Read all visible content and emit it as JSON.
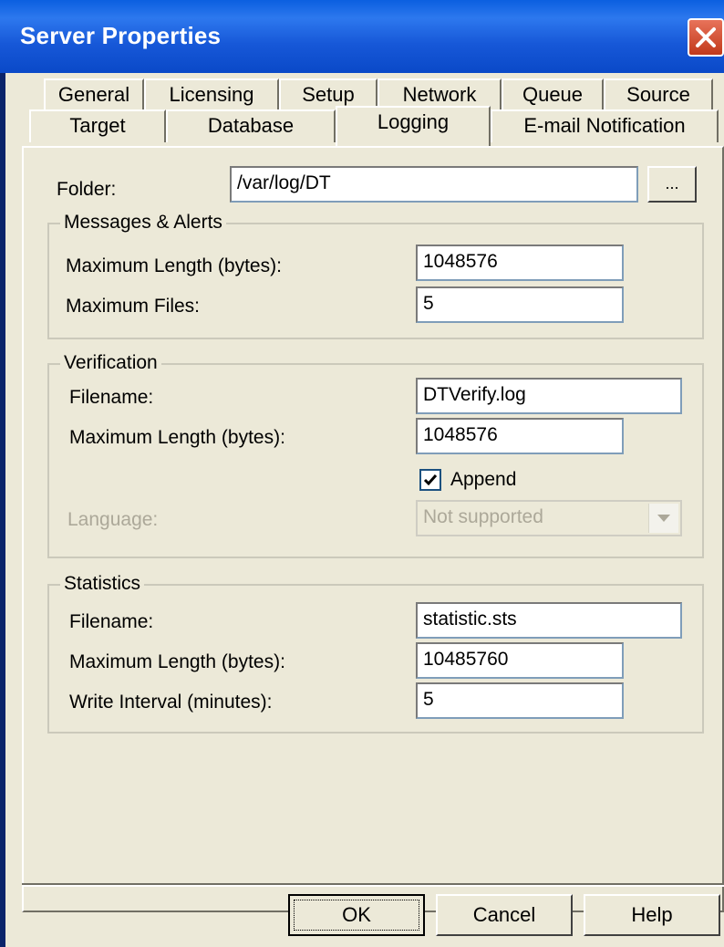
{
  "window": {
    "title": "Server Properties"
  },
  "tabs": {
    "row1": [
      "General",
      "Licensing",
      "Setup",
      "Network",
      "Queue",
      "Source"
    ],
    "row2": [
      "Target",
      "Database",
      "Logging",
      "E-mail Notification"
    ],
    "active": "Logging"
  },
  "folder": {
    "label": "Folder:",
    "value": "/var/log/DT",
    "browse_label": "..."
  },
  "messages": {
    "title": "Messages & Alerts",
    "max_length_label": "Maximum Length (bytes):",
    "max_length_value": "1048576",
    "max_files_label": "Maximum Files:",
    "max_files_value": "5"
  },
  "verification": {
    "title": "Verification",
    "filename_label": "Filename:",
    "filename_value": "DTVerify.log",
    "max_length_label": "Maximum Length (bytes):",
    "max_length_value": "1048576",
    "append_label": "Append",
    "append_checked": true,
    "language_label": "Language:",
    "language_value": "Not supported"
  },
  "statistics": {
    "title": "Statistics",
    "filename_label": "Filename:",
    "filename_value": "statistic.sts",
    "max_length_label": "Maximum Length (bytes):",
    "max_length_value": "10485760",
    "interval_label": "Write Interval (minutes):",
    "interval_value": "5"
  },
  "buttons": {
    "ok": "OK",
    "cancel": "Cancel",
    "help": "Help"
  },
  "icons": {
    "close": "close-icon",
    "checkmark": "checkmark-icon",
    "dropdown": "chevron-down-icon"
  }
}
